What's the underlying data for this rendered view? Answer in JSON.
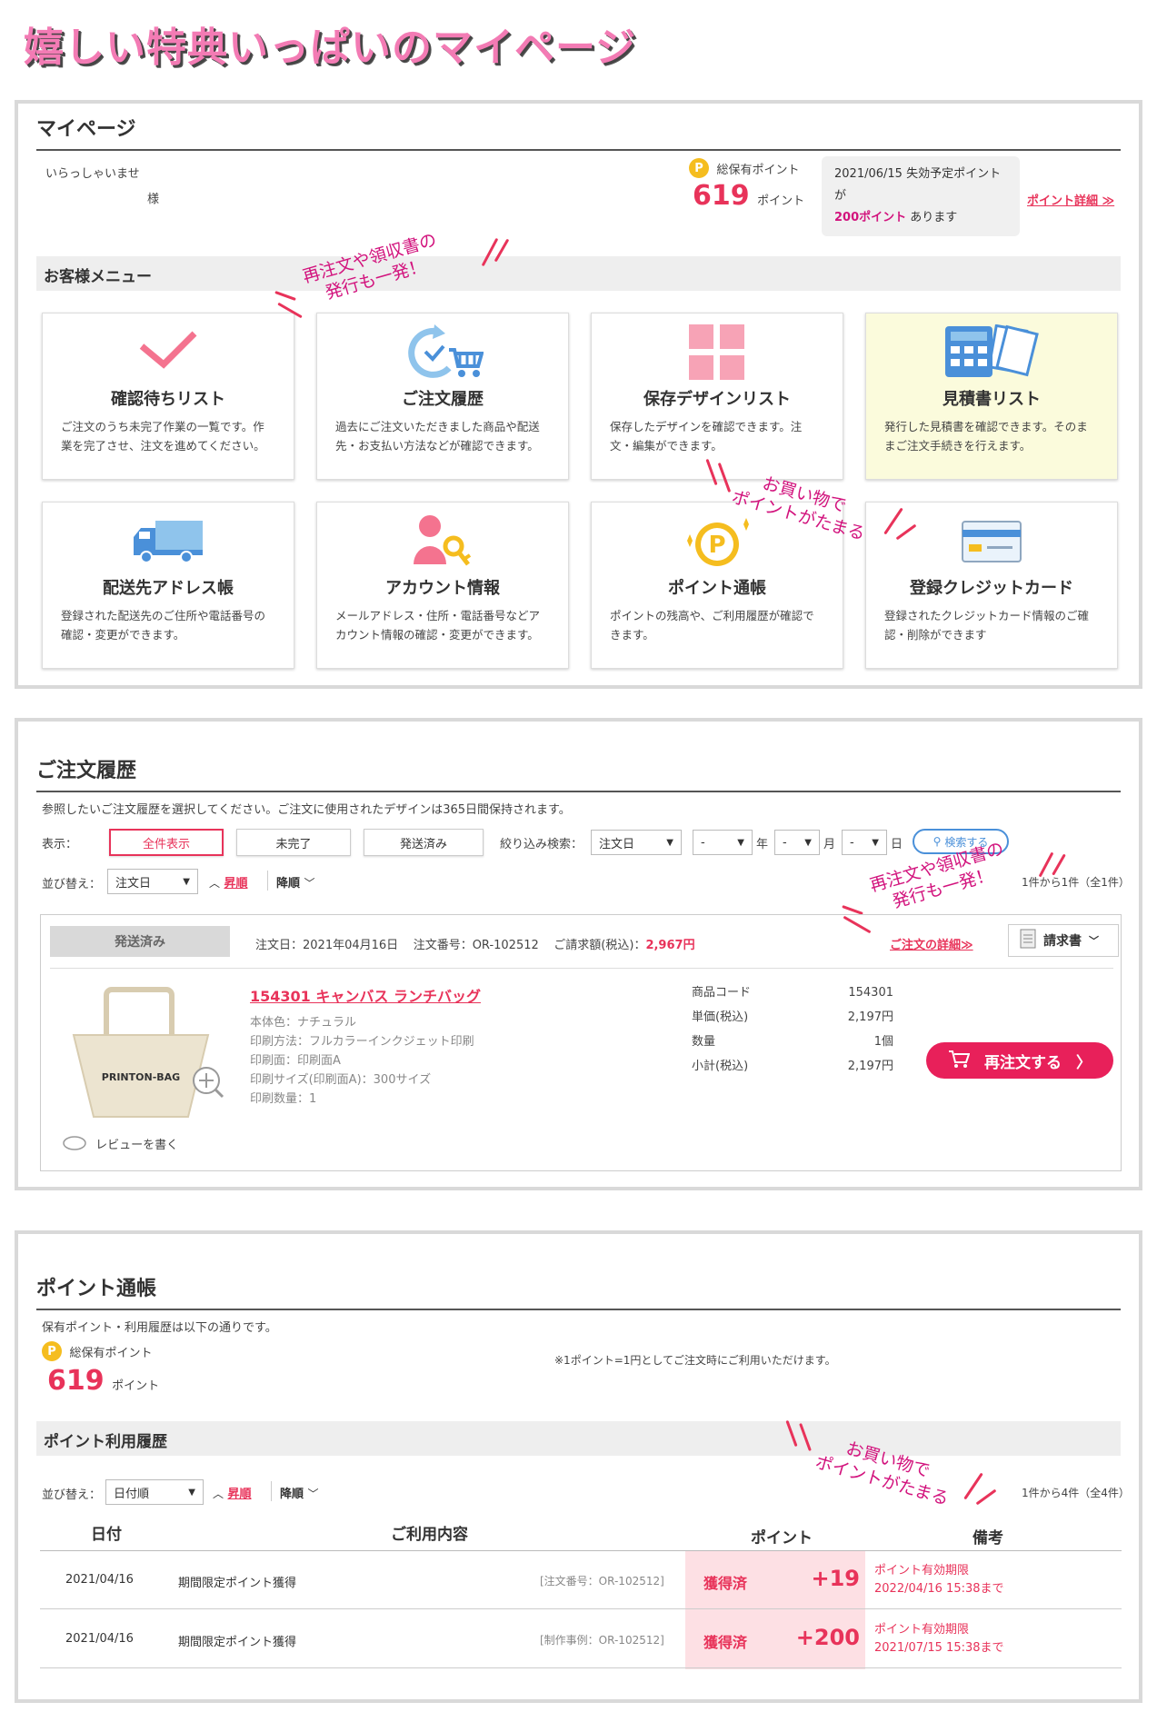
{
  "banner": {
    "title": "嬉しい特典いっぱいのマイページ"
  },
  "mypage": {
    "title": "マイページ",
    "welcome": "いらっしゃいませ",
    "sama": "様",
    "points_label": "総保有ポイント",
    "points_value": "619",
    "points_unit": "ポイント",
    "expire_date": "2021/06/15",
    "expire_text": "失効予定ポイントが",
    "expire_points": "200ポイント",
    "expire_suffix": "あります",
    "point_detail_link": "ポイント詳細 ≫",
    "menu_heading": "お客様メニュー",
    "cards": [
      {
        "title": "確認待ちリスト",
        "desc": "ご注文のうち未完了作業の一覧です。作業を完了させ、注文を進めてください。",
        "icon": "check-icon"
      },
      {
        "title": "ご注文履歴",
        "desc": "過去にご注文いただきました商品や配送先・お支払い方法などが確認できます。",
        "icon": "cart-history-icon"
      },
      {
        "title": "保存デザインリスト",
        "desc": "保存したデザインを確認できます。注文・編集ができます。",
        "icon": "grid-icon"
      },
      {
        "title": "見積書リスト",
        "desc": "発行した見積書を確認できます。そのままご注文手続きを行えます。",
        "icon": "calculator-icon"
      },
      {
        "title": "配送先アドレス帳",
        "desc": "登録された配送先のご住所や電話番号の確認・変更ができます。",
        "icon": "truck-icon"
      },
      {
        "title": "アカウント情報",
        "desc": "メールアドレス・住所・電話番号などアカウント情報の確認・変更ができます。",
        "icon": "person-key-icon"
      },
      {
        "title": "ポイント通帳",
        "desc": "ポイントの残高や、ご利用履歴が確認できます。",
        "icon": "point-coin-icon"
      },
      {
        "title": "登録クレジットカード",
        "desc": "登録されたクレジットカード情報のご確認・削除ができます",
        "icon": "credit-card-icon"
      }
    ],
    "anno1": [
      "再注文や領収書の",
      "発行も一発！"
    ],
    "anno2": [
      "お買い物で",
      "ポイントがたまる"
    ]
  },
  "orders": {
    "title": "ご注文履歴",
    "note": "参照したいご注文履歴を選択してください。ご注文に使用されたデザインは365日間保持されます。",
    "display_label": "表示：",
    "filters": [
      "全件表示",
      "未完了",
      "発送済み"
    ],
    "search_label": "絞り込み検索：",
    "search_field": "注文日",
    "year_value": "-",
    "year_unit": "年",
    "month_value": "-",
    "month_unit": "月",
    "day_value": "-",
    "day_unit": "日",
    "search_button": "検索する",
    "sort_label": "並び替え：",
    "sort_value": "注文日",
    "sort_asc": "昇順",
    "sort_desc": "降順",
    "count": "1件から1件（全1件）",
    "anno": [
      "再注文や領収書の",
      "発行も一発！"
    ],
    "order": {
      "status": "発送済み",
      "date": "注文日：2021年04月16日",
      "number": "注文番号：OR-102512",
      "amount_label": "ご請求額(税込)：",
      "amount": "2,967円",
      "detail_link": "ご注文の詳細≫",
      "invoice": "請求書",
      "product_name": "154301 キャンバス ランチバッグ",
      "product_bag_text": "PRINTON-BAG",
      "specs": [
        "本体色：ナチュラル",
        "印刷方法：フルカラーインクジェット印刷",
        "印刷面：印刷面A",
        "印刷サイズ(印刷面A)：300サイズ",
        "印刷数量：1"
      ],
      "kv": [
        {
          "k": "商品コード",
          "v": "154301"
        },
        {
          "k": "単価(税込)",
          "v": "2,197円"
        },
        {
          "k": "数量",
          "v": "1個"
        },
        {
          "k": "小計(税込)",
          "v": "2,197円"
        }
      ],
      "reorder": "再注文する",
      "review": "レビューを書く"
    }
  },
  "pointbook": {
    "title": "ポイント通帳",
    "note": "保有ポイント・利用履歴は以下の通りです。",
    "points_label": "総保有ポイント",
    "points_value": "619",
    "points_unit": "ポイント",
    "rate_note": "※1ポイント=1円としてご注文時にご利用いただけます。",
    "history_heading": "ポイント利用履歴",
    "sort_label": "並び替え：",
    "sort_value": "日付順",
    "sort_asc": "昇順",
    "sort_desc": "降順",
    "count": "1件から4件（全4件）",
    "anno": [
      "お買い物で",
      "ポイントがたまる"
    ],
    "headers": {
      "date": "日付",
      "content": "ご利用内容",
      "points": "ポイント",
      "remarks": "備考"
    },
    "rows": [
      {
        "date": "2021/04/16",
        "content": "期間限定ポイント獲得",
        "ref": "[注文番号：OR-102512]",
        "status": "獲得済",
        "points": "+19",
        "remark1": "ポイント有効期限",
        "remark2": "2022/04/16 15:38まで"
      },
      {
        "date": "2021/04/16",
        "content": "期間限定ポイント獲得",
        "ref": "[制作事例：OR-102512]",
        "status": "獲得済",
        "points": "+200",
        "remark1": "ポイント有効期限",
        "remark2": "2021/07/15 15:38まで"
      }
    ]
  },
  "colors": {
    "accent": "#e8335a",
    "magenta": "#d2137d",
    "point_gold": "#f5bd1f",
    "quote_yellow": "#fbfbdc"
  }
}
